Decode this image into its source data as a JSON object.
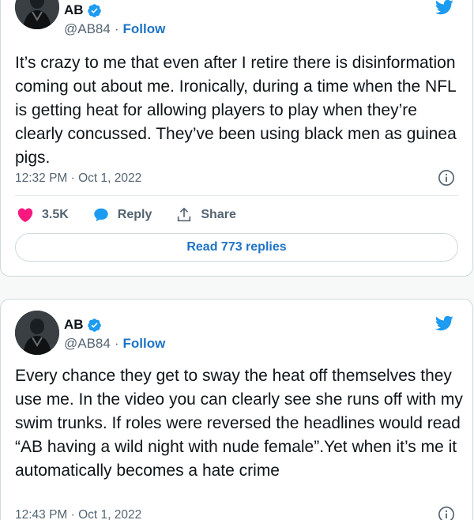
{
  "tweets": [
    {
      "author": {
        "name": "AB",
        "handle": "@AB84",
        "follow_label": "Follow",
        "separator": "·"
      },
      "text": "It’s crazy to me that even after I retire there is disinformation coming out about me. Ironically, during a time when the NFL is getting heat for allowing players to play when they’re clearly concussed. They’ve been using black men as guinea pigs.",
      "timestamp": "12:32 PM · Oct 1, 2022",
      "like_count": "3.5K",
      "reply_label": "Reply",
      "share_label": "Share",
      "read_replies_label": "Read 773 replies"
    },
    {
      "author": {
        "name": "AB",
        "handle": "@AB84",
        "follow_label": "Follow",
        "separator": "·"
      },
      "text": "Every chance they get to sway the heat off themselves they use me. In the video you can clearly see she runs off with my swim trunks. If roles were reversed the headlines would read “AB having a wild night with nude female”.Yet when it’s me it automatically becomes a hate crime",
      "timestamp": "12:43 PM · Oct 1, 2022"
    }
  ],
  "icons": {
    "verified": "verified-badge-icon",
    "bird": "twitter-bird-icon",
    "info": "info-icon",
    "like": "heart-icon",
    "reply": "reply-bubble-icon",
    "share": "share-icon"
  },
  "colors": {
    "brand_blue": "#1d9bf0",
    "link_blue": "#1d73c6",
    "like_red": "#f91880",
    "muted_text": "#536471",
    "text": "#0f1419",
    "border": "#cfd9de"
  }
}
